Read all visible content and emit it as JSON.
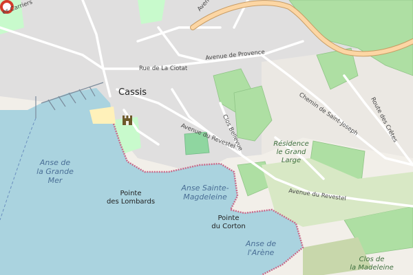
{
  "map": {
    "labels": {
      "town": "Cassis",
      "avenue_foch": "Avenue du Maréchal Foch",
      "avenue_provence": "Avenue de Provence",
      "rue_ciotat": "Rue de La Ciotat",
      "les_carriers": "es Carriers",
      "chemin_saint_joseph": "Chemin de Saint-Joseph",
      "route_cretes": "Route des Crêtes",
      "avenue_revestel": "Avenue du Revestel",
      "avenue_revestel_2": "Avenue du Revestel",
      "clos_bellevue": "Clos Bellevue",
      "anse_grande_mer_1": "Anse de",
      "anse_grande_mer_2": "la Grande",
      "anse_grande_mer_3": "Mer",
      "pointe_lombards_1": "Pointe",
      "pointe_lombards_2": "des Lombards",
      "anse_magdeleine_1": "Anse Sainte-",
      "anse_magdeleine_2": "Magdeleine",
      "pointe_corton_1": "Pointe",
      "pointe_corton_2": "du Corton",
      "anse_arene_1": "Anse de",
      "anse_arene_2": "l'Arène",
      "residence_1": "Résidence",
      "residence_2": "le Grand",
      "residence_3": "Large",
      "clos_madeleine_1": "Clos de",
      "clos_madeleine_2": "la Madeleine"
    },
    "icons": {
      "location_marker": "location-pin-icon",
      "castle": "castle-icon"
    },
    "colors": {
      "sea": "#aad3df",
      "land": "#f2efe9",
      "residential": "#e0dfdf",
      "vineyard": "#aedfa3",
      "park": "#c8facc",
      "major_road": "#fcd6a4",
      "beach": "#fff1ba",
      "marker": "#d43c2a"
    }
  }
}
